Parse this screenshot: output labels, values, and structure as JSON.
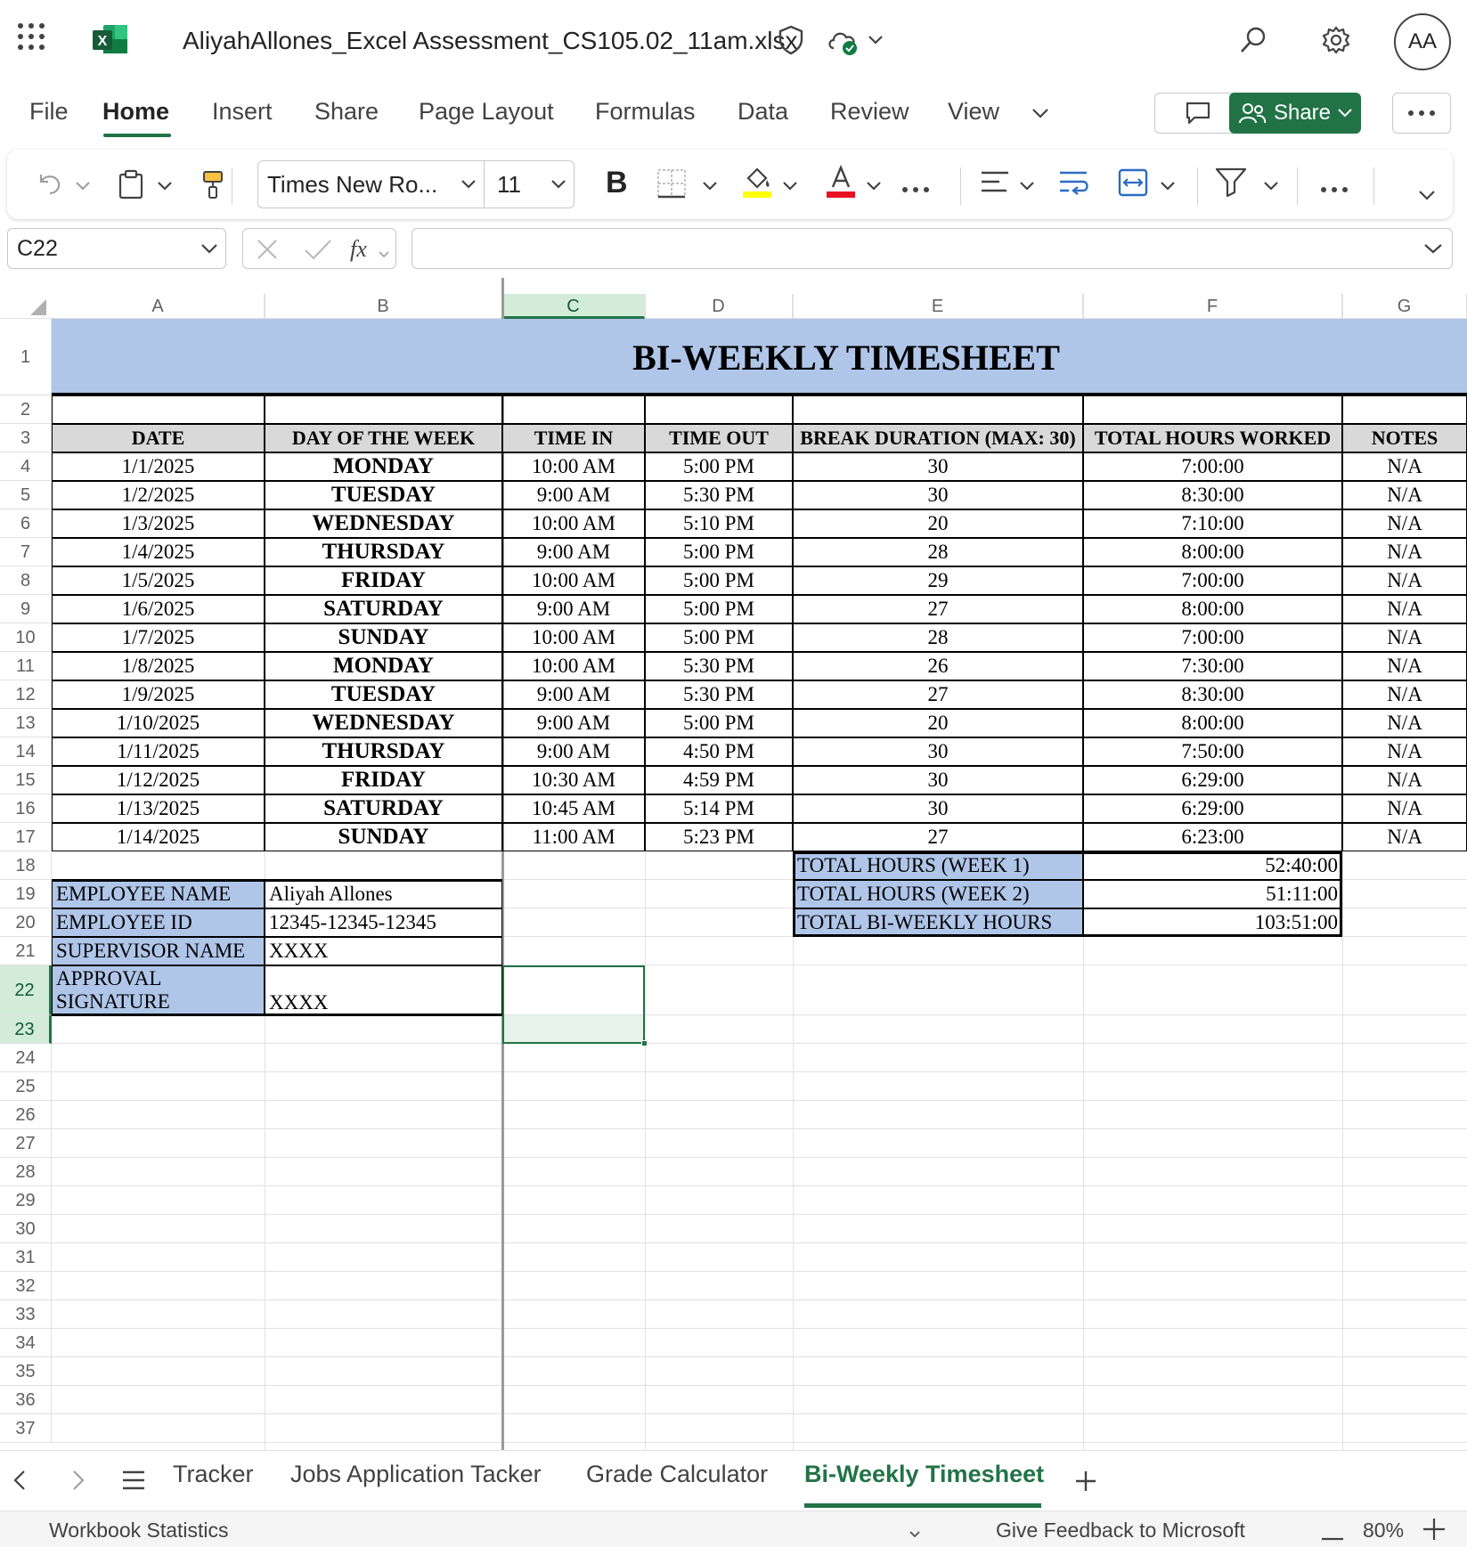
{
  "app": {
    "file_name": "AliyahAllones_Excel Assessment_CS105.02_11am.xlsx",
    "avatar_initials": "AA",
    "brand_color": "#217346"
  },
  "menu": {
    "tabs": [
      "File",
      "Home",
      "Insert",
      "Share",
      "Page Layout",
      "Formulas",
      "Data",
      "Review",
      "View"
    ],
    "active": "Home",
    "share_label": "Share"
  },
  "ribbon": {
    "font_name": "Times New Ro...",
    "font_size": "11",
    "bold_label": "B",
    "fill_color": "#ffff00",
    "font_color": "#e81123"
  },
  "formula_bar": {
    "name_box": "C22",
    "fx_label": "fx",
    "formula": ""
  },
  "columns": [
    "A",
    "B",
    "C",
    "D",
    "E",
    "F",
    "G"
  ],
  "selected_column": "C",
  "rows": [
    "1",
    "2",
    "3",
    "4",
    "5",
    "6",
    "7",
    "8",
    "9",
    "10",
    "11",
    "12",
    "13",
    "14",
    "15",
    "16",
    "17",
    "18",
    "19",
    "20",
    "21",
    "22",
    "23",
    "24",
    "25",
    "26",
    "27",
    "28",
    "29",
    "30",
    "31",
    "32",
    "33",
    "34",
    "35",
    "36",
    "37"
  ],
  "sheet": {
    "title": "BI-WEEKLY TIMESHEET",
    "header_fill": "#afc6e9",
    "headers": [
      "DATE",
      "DAY OF THE WEEK",
      "TIME IN",
      "TIME OUT",
      "BREAK DURATION (MAX: 30)",
      "TOTAL HOURS WORKED",
      "NOTES"
    ],
    "data": [
      [
        "1/1/2025",
        "MONDAY",
        "10:00 AM",
        "5:00 PM",
        "30",
        "7:00:00",
        "N/A"
      ],
      [
        "1/2/2025",
        "TUESDAY",
        "9:00 AM",
        "5:30 PM",
        "30",
        "8:30:00",
        "N/A"
      ],
      [
        "1/3/2025",
        "WEDNESDAY",
        "10:00 AM",
        "5:10 PM",
        "20",
        "7:10:00",
        "N/A"
      ],
      [
        "1/4/2025",
        "THURSDAY",
        "9:00 AM",
        "5:00 PM",
        "28",
        "8:00:00",
        "N/A"
      ],
      [
        "1/5/2025",
        "FRIDAY",
        "10:00 AM",
        "5:00 PM",
        "29",
        "7:00:00",
        "N/A"
      ],
      [
        "1/6/2025",
        "SATURDAY",
        "9:00 AM",
        "5:00 PM",
        "27",
        "8:00:00",
        "N/A"
      ],
      [
        "1/7/2025",
        "SUNDAY",
        "10:00 AM",
        "5:00 PM",
        "28",
        "7:00:00",
        "N/A"
      ],
      [
        "1/8/2025",
        "MONDAY",
        "10:00 AM",
        "5:30 PM",
        "26",
        "7:30:00",
        "N/A"
      ],
      [
        "1/9/2025",
        "TUESDAY",
        "9:00 AM",
        "5:30 PM",
        "27",
        "8:30:00",
        "N/A"
      ],
      [
        "1/10/2025",
        "WEDNESDAY",
        "9:00 AM",
        "5:00 PM",
        "20",
        "8:00:00",
        "N/A"
      ],
      [
        "1/11/2025",
        "THURSDAY",
        "9:00 AM",
        "4:50 PM",
        "30",
        "7:50:00",
        "N/A"
      ],
      [
        "1/12/2025",
        "FRIDAY",
        "10:30 AM",
        "4:59 PM",
        "30",
        "6:29:00",
        "N/A"
      ],
      [
        "1/13/2025",
        "SATURDAY",
        "10:45 AM",
        "5:14 PM",
        "30",
        "6:29:00",
        "N/A"
      ],
      [
        "1/14/2025",
        "SUNDAY",
        "11:00 AM",
        "5:23 PM",
        "27",
        "6:23:00",
        "N/A"
      ]
    ],
    "totals": [
      {
        "label": "TOTAL HOURS (WEEK 1)",
        "value": "52:40:00"
      },
      {
        "label": "TOTAL HOURS (WEEK 2)",
        "value": "51:11:00"
      },
      {
        "label": "TOTAL BI-WEEKLY HOURS",
        "value": "103:51:00"
      }
    ],
    "employee": [
      {
        "label": "EMPLOYEE NAME",
        "value": "Aliyah Allones"
      },
      {
        "label": "EMPLOYEE ID",
        "value": "12345-12345-12345"
      },
      {
        "label": "SUPERVISOR NAME",
        "value": "XXXX"
      },
      {
        "label": "APPROVAL SIGNATURE",
        "value": "XXXX"
      }
    ]
  },
  "sheet_tabs": {
    "items": [
      "Tracker",
      "Jobs Application Tacker",
      "Grade Calculator",
      "Bi-Weekly Timesheet"
    ],
    "active": "Bi-Weekly Timesheet"
  },
  "status_bar": {
    "left": "Workbook Statistics",
    "feedback": "Give Feedback to Microsoft",
    "zoom": "80%"
  }
}
